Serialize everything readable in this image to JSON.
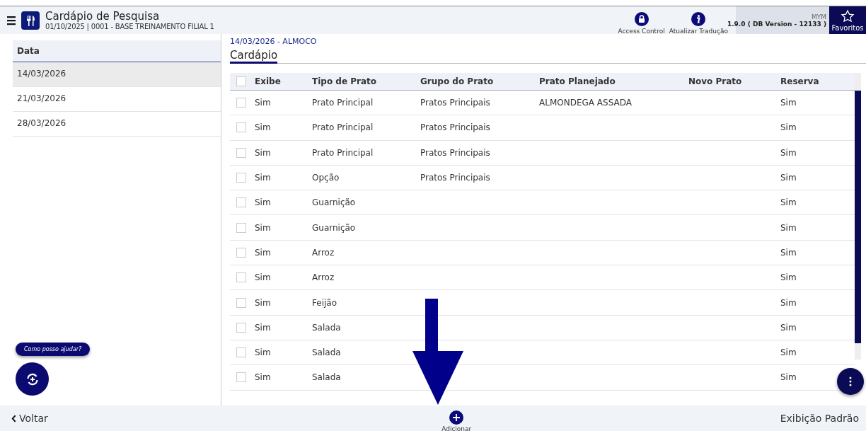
{
  "app": {
    "title": "Cardápio de Pesquisa",
    "subtitle": "01/10/2025 | 0001 - BASE TREINAMENTO FILIAL 1"
  },
  "toolbar": [
    {
      "kind": "lock",
      "label": "Access Control"
    },
    {
      "kind": "info",
      "label": "Atualizar Tradução"
    }
  ],
  "version": {
    "user": "MYM",
    "text": "1.9.0 ( DB Version - 12133 )"
  },
  "favorites": {
    "label": "Favoritos"
  },
  "sidebar": {
    "header": "Data",
    "items": [
      {
        "label": "14/03/2026",
        "selected": true
      },
      {
        "label": "21/03/2026",
        "selected": false
      },
      {
        "label": "28/03/2026",
        "selected": false
      }
    ]
  },
  "assistant": {
    "label": "Como posso ajudar?"
  },
  "content": {
    "breadcrumb": "14/03/2026 - ALMOCO",
    "tab": "Cardápio"
  },
  "table": {
    "header_checked": false,
    "columns": [
      "Exibe",
      "Tipo de Prato",
      "Grupo do Prato",
      "Prato Planejado",
      "Novo Prato",
      "Reserva"
    ],
    "rows": [
      {
        "checked": false,
        "cells": [
          "Sim",
          "Prato Principal",
          "Pratos Principais",
          "ALMONDEGA ASSADA",
          "",
          "Sim"
        ]
      },
      {
        "checked": false,
        "cells": [
          "Sim",
          "Prato Principal",
          "Pratos Principais",
          "",
          "",
          "Sim"
        ]
      },
      {
        "checked": false,
        "cells": [
          "Sim",
          "Prato Principal",
          "Pratos Principais",
          "",
          "",
          "Sim"
        ]
      },
      {
        "checked": false,
        "cells": [
          "Sim",
          "Opção",
          "Pratos Principais",
          "",
          "",
          "Sim"
        ]
      },
      {
        "checked": false,
        "cells": [
          "Sim",
          "Guarnição",
          "",
          "",
          "",
          "Sim"
        ]
      },
      {
        "checked": false,
        "cells": [
          "Sim",
          "Guarnição",
          "",
          "",
          "",
          "Sim"
        ]
      },
      {
        "checked": false,
        "cells": [
          "Sim",
          "Arroz",
          "",
          "",
          "",
          "Sim"
        ]
      },
      {
        "checked": false,
        "cells": [
          "Sim",
          "Arroz",
          "",
          "",
          "",
          "Sim"
        ]
      },
      {
        "checked": false,
        "cells": [
          "Sim",
          "Feijão",
          "",
          "",
          "",
          "Sim"
        ]
      },
      {
        "checked": false,
        "cells": [
          "Sim",
          "Salada",
          "",
          "",
          "",
          "Sim"
        ]
      },
      {
        "checked": false,
        "cells": [
          "Sim",
          "Salada",
          "",
          "",
          "",
          "Sim"
        ]
      },
      {
        "checked": false,
        "cells": [
          "Sim",
          "Salada",
          "",
          "",
          "",
          "Sim"
        ]
      }
    ]
  },
  "footer": {
    "back": "Voltar",
    "add": "Adicionar",
    "view": "Exibição Padrão"
  }
}
